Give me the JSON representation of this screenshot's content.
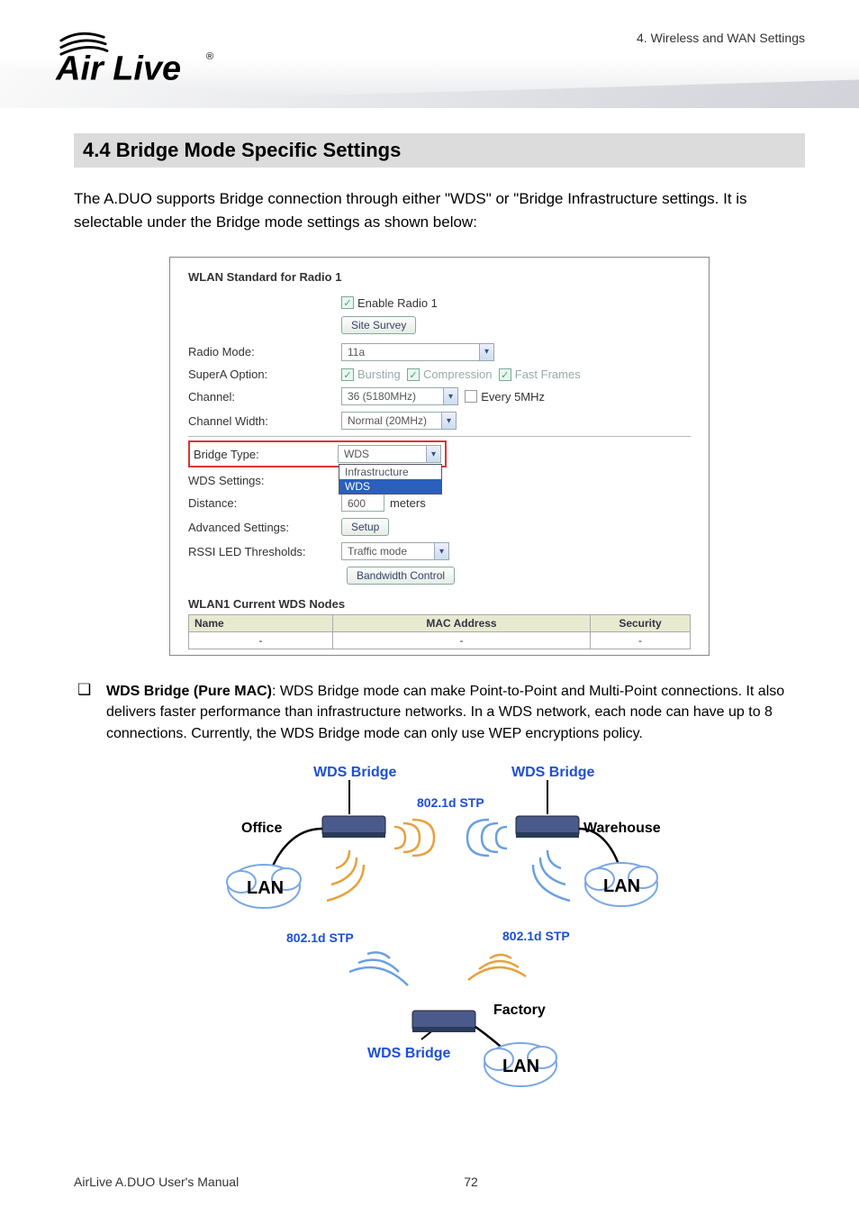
{
  "chapter_label": "4. Wireless and WAN Settings",
  "logo_text": "Air Live",
  "logo_reg": "®",
  "section_heading": "4.4  Bridge Mode Specific Settings",
  "intro_text": "The A.DUO supports Bridge connection through either \"WDS\" or \"Bridge Infrastructure settings.    It is selectable under the Bridge mode settings as shown below:",
  "screenshot": {
    "title": "WLAN Standard for Radio 1",
    "enable_label": "Enable Radio 1",
    "site_survey_btn": "Site Survey",
    "rows": {
      "radio_mode": {
        "label": "Radio Mode:",
        "value": "11a"
      },
      "supera": {
        "label": "SuperA Option:",
        "opts": [
          "Bursting",
          "Compression",
          "Fast Frames"
        ]
      },
      "channel": {
        "label": "Channel:",
        "value": "36 (5180MHz)",
        "every_label": "Every 5MHz"
      },
      "ch_width": {
        "label": "Channel Width:",
        "value": "Normal (20MHz)"
      },
      "bridge_type": {
        "label": "Bridge Type:",
        "value": "WDS",
        "options": [
          "Infrastructure",
          "WDS"
        ]
      },
      "wds_settings": {
        "label": "WDS Settings:"
      },
      "distance": {
        "label": "Distance:",
        "value": "600",
        "unit": "meters"
      },
      "advanced": {
        "label": "Advanced Settings:",
        "btn": "Setup"
      },
      "rssi": {
        "label": "RSSI LED Thresholds:",
        "value": "Traffic mode"
      },
      "bw_btn": "Bandwidth Control"
    },
    "wds_nodes_title": "WLAN1 Current WDS Nodes",
    "table": {
      "headers": [
        "Name",
        "MAC Address",
        "Security"
      ],
      "row": [
        "-",
        "-",
        "-"
      ]
    }
  },
  "bullet": {
    "title": "WDS Bridge (Pure MAC)",
    "body": ":   WDS Bridge mode can make Point-to-Point and Multi-Point connections.    It also delivers faster performance than infrastructure networks.    In a WDS network, each node can have up to 8 connections.    Currently, the WDS Bridge mode can only use WEP encryptions policy."
  },
  "diagram": {
    "wds_bridge": "WDS Bridge",
    "stp": "802.1d STP",
    "office": "Office",
    "warehouse": "Warehouse",
    "factory": "Factory",
    "lan": "LAN"
  },
  "footer": {
    "manual": "AirLive A.DUO User's Manual",
    "page": "72"
  }
}
